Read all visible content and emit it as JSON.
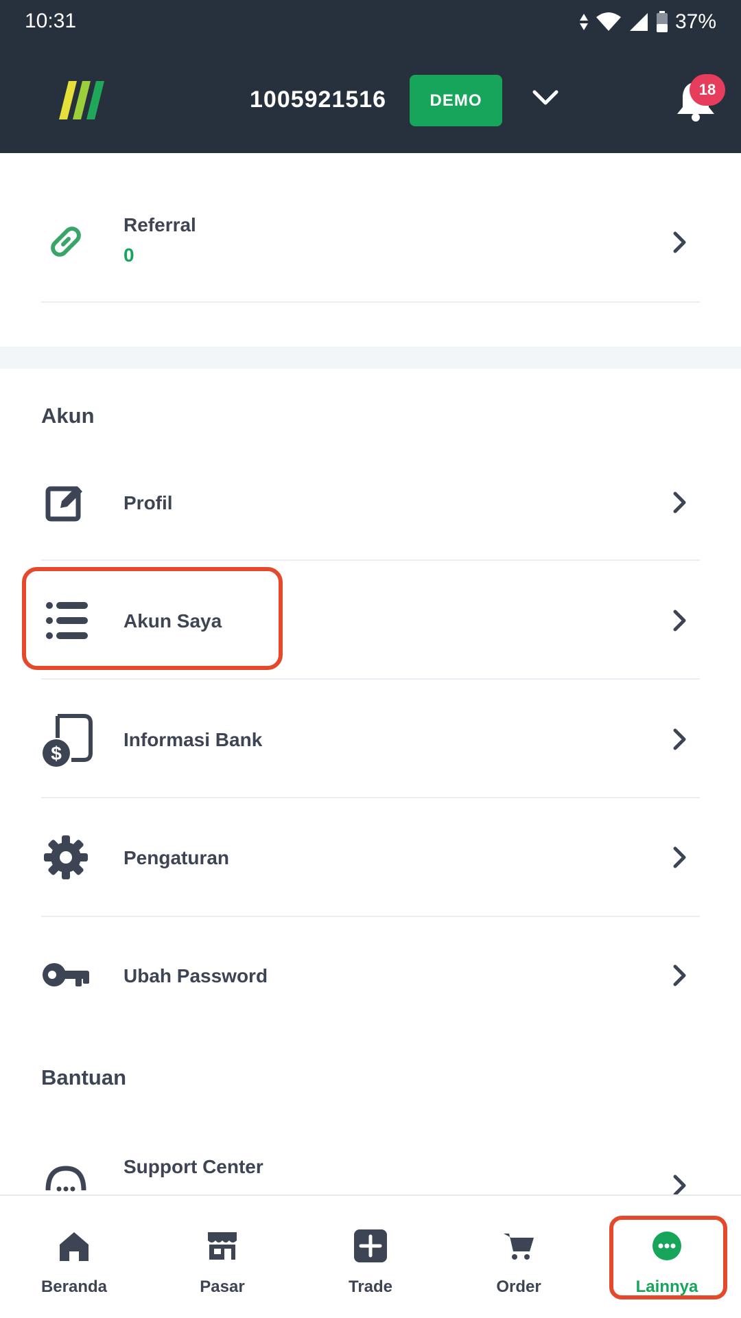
{
  "status_bar": {
    "time": "10:31",
    "battery": "37%"
  },
  "header": {
    "account_number": "1005921516",
    "mode_label": "DEMO",
    "notification_count": "18"
  },
  "referral": {
    "label": "Referral",
    "value": "0"
  },
  "account_section": {
    "title": "Akun",
    "items": [
      {
        "label": "Profil",
        "icon": "edit-icon"
      },
      {
        "label": "Akun Saya",
        "icon": "list-icon"
      },
      {
        "label": "Informasi Bank",
        "icon": "bank-doc-icon"
      },
      {
        "label": "Pengaturan",
        "icon": "gear-icon"
      },
      {
        "label": "Ubah Password",
        "icon": "key-icon"
      }
    ]
  },
  "help_section": {
    "title": "Bantuan",
    "items": [
      {
        "label": "Support Center",
        "icon": "support-icon"
      }
    ]
  },
  "bottom_nav": {
    "items": [
      {
        "label": "Beranda",
        "icon": "home-icon"
      },
      {
        "label": "Pasar",
        "icon": "store-icon"
      },
      {
        "label": "Trade",
        "icon": "plus-icon"
      },
      {
        "label": "Order",
        "icon": "cart-icon"
      },
      {
        "label": "Lainnya",
        "icon": "more-icon"
      }
    ],
    "active": "Lainnya"
  },
  "colors": {
    "header_bg": "#27303d",
    "accent_green": "#16a55a",
    "badge_red": "#e53d5b",
    "highlight": "#e5492c",
    "text": "#3d4554"
  }
}
